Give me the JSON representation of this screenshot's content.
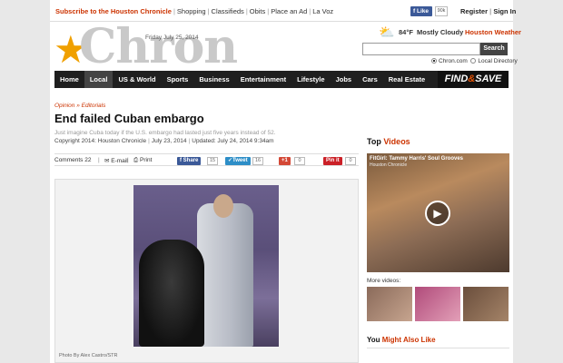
{
  "topbar": {
    "subscribe": "Subscribe to the Houston Chronicle",
    "links": [
      "Shopping",
      "Classifieds",
      "Obits",
      "Place an Ad",
      "La Voz"
    ],
    "facebook_like": "Like",
    "facebook_count": "90k",
    "register": "Register",
    "signin": "Sign In"
  },
  "header": {
    "logo_text": "Chron",
    "date": "Friday July 25, 2014",
    "weather": {
      "temp": "84°F",
      "condition": "Mostly Cloudy",
      "link": "Houston Weather"
    },
    "search_button": "Search",
    "search_placeholder": "",
    "scope_options": [
      "Chron.com",
      "Local Directory"
    ],
    "scope_selected": "Chron.com"
  },
  "nav": {
    "items": [
      "Home",
      "Local",
      "US & World",
      "Sports",
      "Business",
      "Entertainment",
      "Lifestyle",
      "Jobs",
      "Cars",
      "Real Estate"
    ],
    "active": "Local",
    "promo_left": "FIND",
    "promo_amp": "&",
    "promo_right": "SAVE"
  },
  "article": {
    "breadcrumb": "Opinion » Editorials",
    "title": "End failed Cuban embargo",
    "dek": "Just imagine Cuba today if the U.S. embargo had lasted just five years instead of 52.",
    "copyright": "Copyright 2014: Houston Chronicle",
    "published": "July 23, 2014",
    "updated": "Updated: July 24, 2014 9:34am",
    "photo_credit": "Photo By Alex Castro/STR"
  },
  "tools": {
    "comments": "Comments 22",
    "email": "E-mail",
    "print": "Print",
    "fb_share": "Share",
    "fb_count": "15",
    "tweet": "Tweet",
    "tweet_count": "16",
    "gplus": "+1",
    "gplus_count": "0",
    "pinit": "Pin it",
    "pin_count": "0"
  },
  "sidebar": {
    "top_videos_a": "Top",
    "top_videos_b": "Videos",
    "video_title": "FitGirl: Tammy Harris' Soul Grooves",
    "video_source": "Houston Chronicle",
    "more_videos": "More videos:",
    "also_like_a": "You",
    "also_like_b": "Might Also Like"
  },
  "colors": {
    "accent": "#cc3300",
    "nav_bg": "#1f1f1f",
    "facebook": "#3b5998",
    "twitter": "#2d8ec7",
    "gplus": "#d34836",
    "pinterest": "#cb2027"
  }
}
